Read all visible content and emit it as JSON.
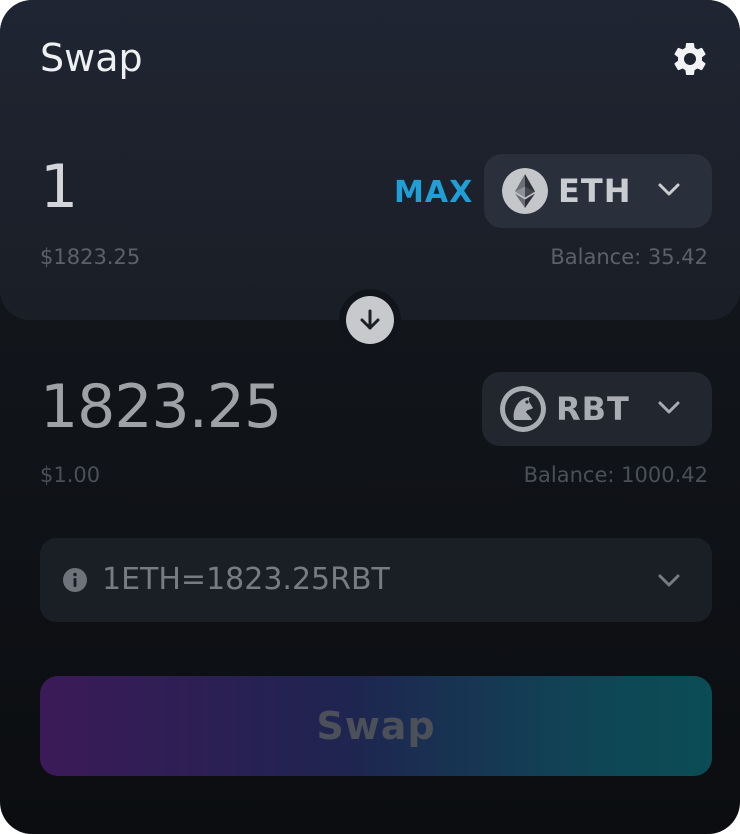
{
  "header": {
    "title": "Swap",
    "settings_icon": "gear-icon"
  },
  "from": {
    "amount": "1",
    "usd_value": "$1823.25",
    "max_label": "MAX",
    "token_symbol": "ETH",
    "token_icon": "ethereum-icon",
    "balance": "Balance: 35.42"
  },
  "switch_icon": "arrow-down-icon",
  "to": {
    "amount": "1823.25",
    "usd_value": "$1.00",
    "token_symbol": "RBT",
    "token_icon": "rbt-token-icon",
    "balance": "Balance: 1000.42"
  },
  "rate": {
    "text": "1ETH=1823.25RBT",
    "icon": "info-icon"
  },
  "action": {
    "label": "Swap"
  },
  "colors": {
    "accent": "#1f9fd6",
    "card_bg": "#101318",
    "panel_bg": "#1f2532",
    "button_gradient": [
      "#3b1a58",
      "#1f2450",
      "#0a4d55"
    ]
  }
}
